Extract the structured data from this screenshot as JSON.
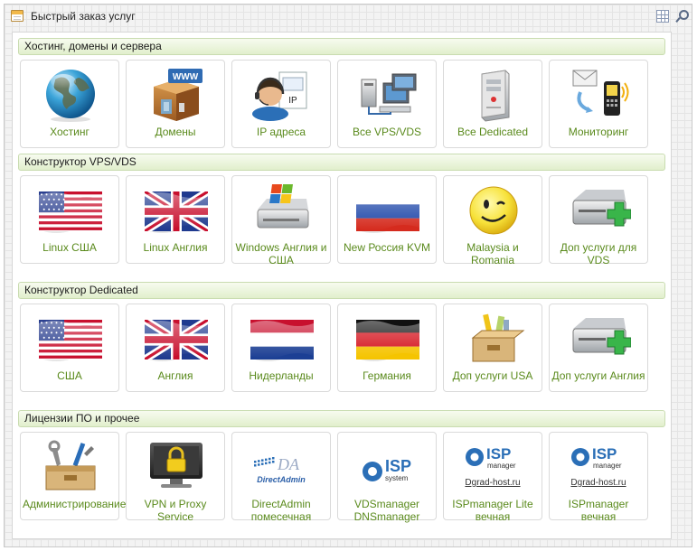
{
  "window": {
    "title": "Быстрый заказ услуг"
  },
  "sections": [
    {
      "title": "Хостинг, домены и сервера",
      "tiles": [
        {
          "label": "Хостинг",
          "icon": "globe-icon"
        },
        {
          "label": "Домены",
          "icon": "www-box-icon"
        },
        {
          "label": "IP адреса",
          "icon": "ip-support-icon"
        },
        {
          "label": "Все VPS/VDS",
          "icon": "computers-network-icon"
        },
        {
          "label": "Все Dedicated",
          "icon": "server-tower-icon"
        },
        {
          "label": "Мониторинг",
          "icon": "phone-mail-icon"
        }
      ]
    },
    {
      "title": "Конструктор VPS/VDS",
      "tiles": [
        {
          "label": "Linux США",
          "icon": "usa-flag-icon"
        },
        {
          "label": "Linux Англия",
          "icon": "uk-flag-icon"
        },
        {
          "label": "Windows Англия и США",
          "icon": "windows-drive-icon"
        },
        {
          "label": "New Россия KVM",
          "icon": "russia-flag-icon"
        },
        {
          "label": "Malaysia и Romania",
          "icon": "smiley-icon"
        },
        {
          "label": "Доп услуги для VDS",
          "icon": "drive-plus-icon"
        }
      ]
    },
    {
      "title": "Конструктор Dedicated",
      "tiles": [
        {
          "label": "США",
          "icon": "usa-flag-icon"
        },
        {
          "label": "Англия",
          "icon": "uk-flag-icon"
        },
        {
          "label": "Нидерланды",
          "icon": "netherlands-flag-icon"
        },
        {
          "label": "Германия",
          "icon": "germany-flag-icon"
        },
        {
          "label": "Доп услуги USA",
          "icon": "tools-box-icon"
        },
        {
          "label": "Доп услуги Англия",
          "icon": "drive-plus-icon"
        }
      ]
    },
    {
      "title": "Лицензии ПО и прочее",
      "tiles": [
        {
          "label": "Администрирование",
          "icon": "toolbox-icon"
        },
        {
          "label": "VPN и Proxy Service",
          "icon": "monitor-lock-icon"
        },
        {
          "label": "DirectAdmin помесечная",
          "icon": "directadmin-logo-icon",
          "logo_text": "DA",
          "logo_sub": "DirectAdmin"
        },
        {
          "label": "VDSmanager DNSmanager",
          "icon": "isp-system-logo-icon",
          "logo_text": "ISP",
          "logo_sub": "system"
        },
        {
          "label": "ISPmanager Lite вечная",
          "icon": "isp-manager-logo-icon",
          "logo_text": "ISP",
          "logo_sub": "manager",
          "sub": "Dgrad-host.ru"
        },
        {
          "label": "ISPmanager вечная",
          "icon": "isp-manager-logo-icon",
          "logo_text": "ISP",
          "logo_sub": "manager",
          "sub": "Dgrad-host.ru"
        }
      ]
    }
  ]
}
